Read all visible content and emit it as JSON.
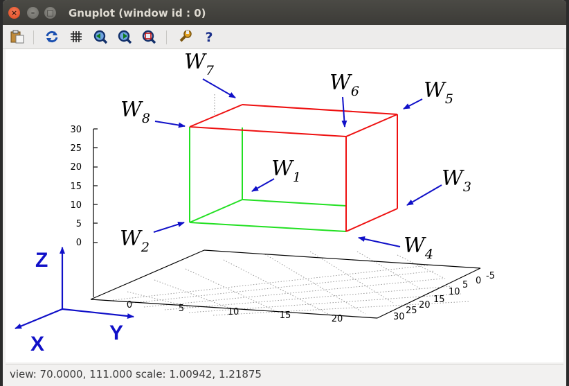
{
  "window": {
    "title": "Gnuplot (window id : 0)",
    "buttons": {
      "close": "×",
      "minimize": "–",
      "maximize": "□"
    }
  },
  "toolbar": {
    "items": [
      {
        "icon": "clipboard-icon"
      },
      {
        "icon": "replot-icon"
      },
      {
        "icon": "grid-icon"
      },
      {
        "icon": "zoom-previous-icon"
      },
      {
        "icon": "zoom-next-icon"
      },
      {
        "icon": "autoscale-icon"
      },
      {
        "icon": "settings-icon"
      },
      {
        "icon": "help-icon",
        "text": "?"
      }
    ]
  },
  "plot": {
    "z_ticks": [
      "30",
      "25",
      "20",
      "15",
      "10",
      "5",
      "0"
    ],
    "y_ticks": [
      "0",
      "5",
      "10",
      "15",
      "20"
    ],
    "x_ticks": [
      "-5",
      "0",
      "5",
      "10",
      "15",
      "20",
      "25",
      "30"
    ],
    "labels": [
      {
        "id": "w1",
        "base": "W",
        "sub": "1"
      },
      {
        "id": "w2",
        "base": "W",
        "sub": "2"
      },
      {
        "id": "w3",
        "base": "W",
        "sub": "3"
      },
      {
        "id": "w4",
        "base": "W",
        "sub": "4"
      },
      {
        "id": "w5",
        "base": "W",
        "sub": "5"
      },
      {
        "id": "w6",
        "base": "W",
        "sub": "6"
      },
      {
        "id": "w7",
        "base": "W",
        "sub": "7"
      },
      {
        "id": "w8",
        "base": "W",
        "sub": "8"
      }
    ],
    "axes": {
      "z": "Z",
      "y": "Y",
      "x": "X"
    },
    "colors": {
      "green": "#00e000",
      "red": "#ee0000",
      "arrow": "#1010c8"
    }
  },
  "status": {
    "text": "view: 70.0000, 111.000  scale: 1.00942, 1.21875"
  }
}
